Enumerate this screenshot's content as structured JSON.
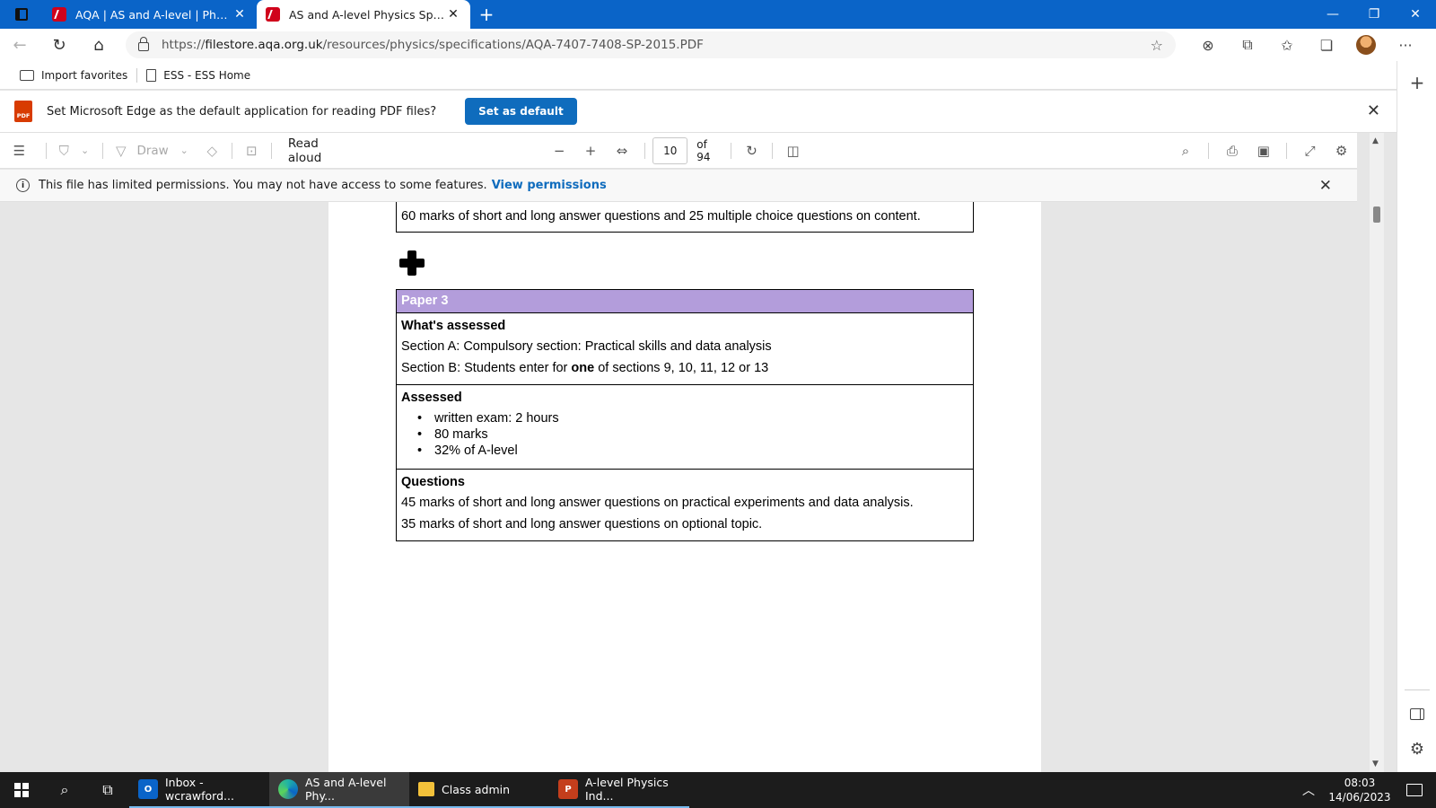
{
  "tabs": [
    {
      "title": "AQA | AS and A-level | Physics | S",
      "close": "✕"
    },
    {
      "title": "AS and A-level Physics Specificat",
      "close": "✕"
    }
  ],
  "new_tab": "+",
  "window_controls": {
    "minimize": "—",
    "restore": "❐",
    "close": "✕"
  },
  "address": {
    "url_prefix": "https://",
    "url_domain": "filestore.aqa.org.uk",
    "url_path": "/resources/physics/specifications/AQA-7407-7408-SP-2015.PDF"
  },
  "favorites": [
    {
      "label": "Import favorites"
    },
    {
      "label": "ESS - ESS Home"
    }
  ],
  "banner": {
    "pdf_badge": "PDF",
    "text": "Set Microsoft Edge as the default application for reading PDF files?",
    "button": "Set as default"
  },
  "pdf_toolbar": {
    "draw_label": "Draw",
    "read_aloud": "Read aloud",
    "page_current": "10",
    "page_total": "of 94"
  },
  "permission": {
    "text": "This file has limited permissions. You may not have access to some features.",
    "link": "View permissions"
  },
  "document": {
    "prev_box_text": "60 marks of short and long answer questions and 25 multiple choice questions on content.",
    "paper_title": "Paper 3",
    "whats_assessed": {
      "heading": "What's assessed",
      "line1": "Section A: Compulsory section: Practical skills and data analysis",
      "line2_pre": "Section B: Students enter for ",
      "line2_bold": "one",
      "line2_post": " of sections 9, 10, 11, 12 or 13"
    },
    "assessed": {
      "heading": "Assessed",
      "bullets": [
        "written exam: 2 hours",
        "80 marks",
        "32% of A-level"
      ]
    },
    "questions": {
      "heading": "Questions",
      "line1": "45 marks of short and long answer questions on practical experiments and data analysis.",
      "line2": "35 marks of short and long answer questions on optional topic."
    }
  },
  "taskbar": {
    "apps": [
      {
        "label": "Inbox - wcrawford...",
        "icon": "O"
      },
      {
        "label": "AS and A-level Phy...",
        "icon": ""
      },
      {
        "label": "Class admin",
        "icon": ""
      },
      {
        "label": "A-level Physics Ind...",
        "icon": "P"
      }
    ],
    "time": "08:03",
    "date": "14/06/2023"
  }
}
